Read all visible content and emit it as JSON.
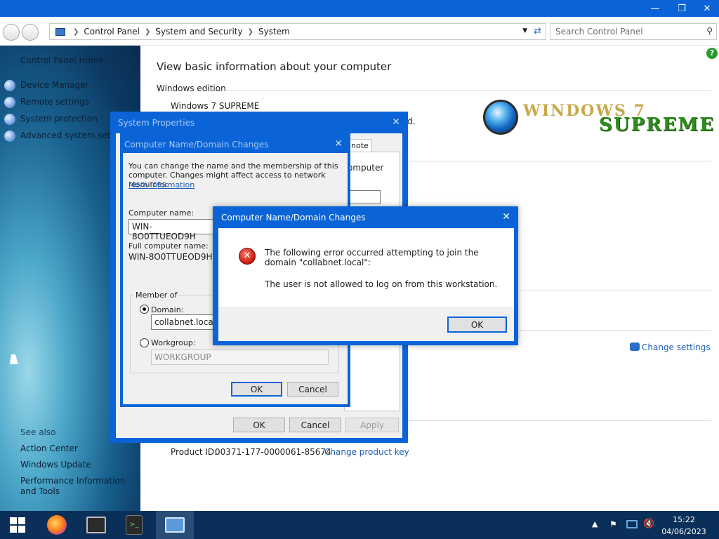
{
  "address": {
    "crumbs": [
      "Control Panel",
      "System and Security",
      "System"
    ],
    "search_placeholder": "Search Control Panel"
  },
  "sidebar": {
    "home": "Control Panel Home",
    "items": [
      {
        "label": "Device Manager"
      },
      {
        "label": "Remote settings"
      },
      {
        "label": "System protection"
      },
      {
        "label": "Advanced system settings"
      }
    ],
    "see_also_title": "See also",
    "see_also": [
      "Action Center",
      "Windows Update",
      "Performance Information and Tools"
    ]
  },
  "main": {
    "heading": "View basic information about your computer",
    "edition_header": "Windows edition",
    "edition": "Windows 7 SUPREME",
    "partial_text": "d.",
    "logo_line1": "WINDOWS 7",
    "logo_line2": "SUPREME",
    "change_settings": "Change settings",
    "product_id_label": "Product ID:",
    "product_id": "00371-177-0000061-85674",
    "change_product_key": "Change product key"
  },
  "system_properties": {
    "title": "System Properties",
    "tab_partial": "note",
    "partial_text": "omputer",
    "ok": "OK",
    "cancel": "Cancel",
    "apply": "Apply"
  },
  "name_dialog": {
    "title": "Computer Name/Domain Changes",
    "description": "You can change the name and the membership of this computer. Changes might affect access to network resources.",
    "more_info": "More information",
    "computer_name_label": "Computer name:",
    "computer_name": "WIN-8O0TTUEOD9H",
    "full_name_label": "Full computer name:",
    "full_name": "WIN-8O0TTUEOD9H",
    "member_of": "Member of",
    "domain_label": "Domain:",
    "domain_value": "collabnet.local",
    "workgroup_label": "Workgroup:",
    "workgroup_value": "WORKGROUP",
    "ok": "OK",
    "cancel": "Cancel"
  },
  "error_dialog": {
    "title": "Computer Name/Domain Changes",
    "message": "The following error occurred attempting to join the domain \"collabnet.local\":",
    "detail": "The user is not allowed to log on from this workstation.",
    "ok": "OK"
  },
  "taskbar": {
    "time": "15:22",
    "date": "04/06/2023"
  },
  "colors": {
    "accent": "#0a64d8",
    "taskbar": "#0a2f58",
    "link": "#1d5db9"
  }
}
